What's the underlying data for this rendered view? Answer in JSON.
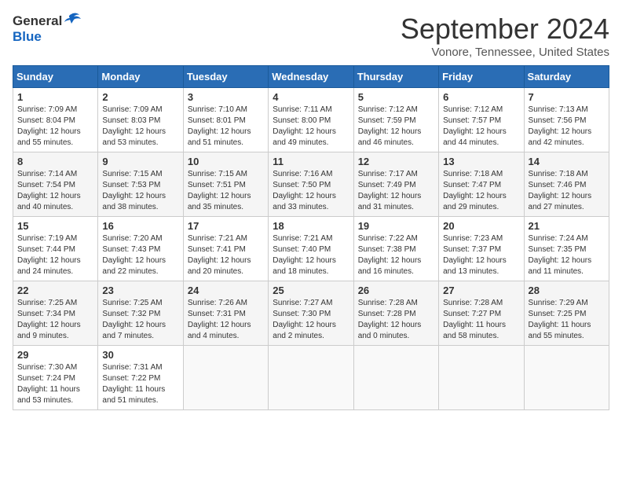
{
  "header": {
    "logo_general": "General",
    "logo_blue": "Blue",
    "month": "September 2024",
    "location": "Vonore, Tennessee, United States"
  },
  "weekdays": [
    "Sunday",
    "Monday",
    "Tuesday",
    "Wednesday",
    "Thursday",
    "Friday",
    "Saturday"
  ],
  "weeks": [
    [
      {
        "day": "1",
        "sunrise": "7:09 AM",
        "sunset": "8:04 PM",
        "daylight": "12 hours and 55 minutes."
      },
      {
        "day": "2",
        "sunrise": "7:09 AM",
        "sunset": "8:03 PM",
        "daylight": "12 hours and 53 minutes."
      },
      {
        "day": "3",
        "sunrise": "7:10 AM",
        "sunset": "8:01 PM",
        "daylight": "12 hours and 51 minutes."
      },
      {
        "day": "4",
        "sunrise": "7:11 AM",
        "sunset": "8:00 PM",
        "daylight": "12 hours and 49 minutes."
      },
      {
        "day": "5",
        "sunrise": "7:12 AM",
        "sunset": "7:59 PM",
        "daylight": "12 hours and 46 minutes."
      },
      {
        "day": "6",
        "sunrise": "7:12 AM",
        "sunset": "7:57 PM",
        "daylight": "12 hours and 44 minutes."
      },
      {
        "day": "7",
        "sunrise": "7:13 AM",
        "sunset": "7:56 PM",
        "daylight": "12 hours and 42 minutes."
      }
    ],
    [
      {
        "day": "8",
        "sunrise": "7:14 AM",
        "sunset": "7:54 PM",
        "daylight": "12 hours and 40 minutes."
      },
      {
        "day": "9",
        "sunrise": "7:15 AM",
        "sunset": "7:53 PM",
        "daylight": "12 hours and 38 minutes."
      },
      {
        "day": "10",
        "sunrise": "7:15 AM",
        "sunset": "7:51 PM",
        "daylight": "12 hours and 35 minutes."
      },
      {
        "day": "11",
        "sunrise": "7:16 AM",
        "sunset": "7:50 PM",
        "daylight": "12 hours and 33 minutes."
      },
      {
        "day": "12",
        "sunrise": "7:17 AM",
        "sunset": "7:49 PM",
        "daylight": "12 hours and 31 minutes."
      },
      {
        "day": "13",
        "sunrise": "7:18 AM",
        "sunset": "7:47 PM",
        "daylight": "12 hours and 29 minutes."
      },
      {
        "day": "14",
        "sunrise": "7:18 AM",
        "sunset": "7:46 PM",
        "daylight": "12 hours and 27 minutes."
      }
    ],
    [
      {
        "day": "15",
        "sunrise": "7:19 AM",
        "sunset": "7:44 PM",
        "daylight": "12 hours and 24 minutes."
      },
      {
        "day": "16",
        "sunrise": "7:20 AM",
        "sunset": "7:43 PM",
        "daylight": "12 hours and 22 minutes."
      },
      {
        "day": "17",
        "sunrise": "7:21 AM",
        "sunset": "7:41 PM",
        "daylight": "12 hours and 20 minutes."
      },
      {
        "day": "18",
        "sunrise": "7:21 AM",
        "sunset": "7:40 PM",
        "daylight": "12 hours and 18 minutes."
      },
      {
        "day": "19",
        "sunrise": "7:22 AM",
        "sunset": "7:38 PM",
        "daylight": "12 hours and 16 minutes."
      },
      {
        "day": "20",
        "sunrise": "7:23 AM",
        "sunset": "7:37 PM",
        "daylight": "12 hours and 13 minutes."
      },
      {
        "day": "21",
        "sunrise": "7:24 AM",
        "sunset": "7:35 PM",
        "daylight": "12 hours and 11 minutes."
      }
    ],
    [
      {
        "day": "22",
        "sunrise": "7:25 AM",
        "sunset": "7:34 PM",
        "daylight": "12 hours and 9 minutes."
      },
      {
        "day": "23",
        "sunrise": "7:25 AM",
        "sunset": "7:32 PM",
        "daylight": "12 hours and 7 minutes."
      },
      {
        "day": "24",
        "sunrise": "7:26 AM",
        "sunset": "7:31 PM",
        "daylight": "12 hours and 4 minutes."
      },
      {
        "day": "25",
        "sunrise": "7:27 AM",
        "sunset": "7:30 PM",
        "daylight": "12 hours and 2 minutes."
      },
      {
        "day": "26",
        "sunrise": "7:28 AM",
        "sunset": "7:28 PM",
        "daylight": "12 hours and 0 minutes."
      },
      {
        "day": "27",
        "sunrise": "7:28 AM",
        "sunset": "7:27 PM",
        "daylight": "11 hours and 58 minutes."
      },
      {
        "day": "28",
        "sunrise": "7:29 AM",
        "sunset": "7:25 PM",
        "daylight": "11 hours and 55 minutes."
      }
    ],
    [
      {
        "day": "29",
        "sunrise": "7:30 AM",
        "sunset": "7:24 PM",
        "daylight": "11 hours and 53 minutes."
      },
      {
        "day": "30",
        "sunrise": "7:31 AM",
        "sunset": "7:22 PM",
        "daylight": "11 hours and 51 minutes."
      },
      null,
      null,
      null,
      null,
      null
    ]
  ]
}
